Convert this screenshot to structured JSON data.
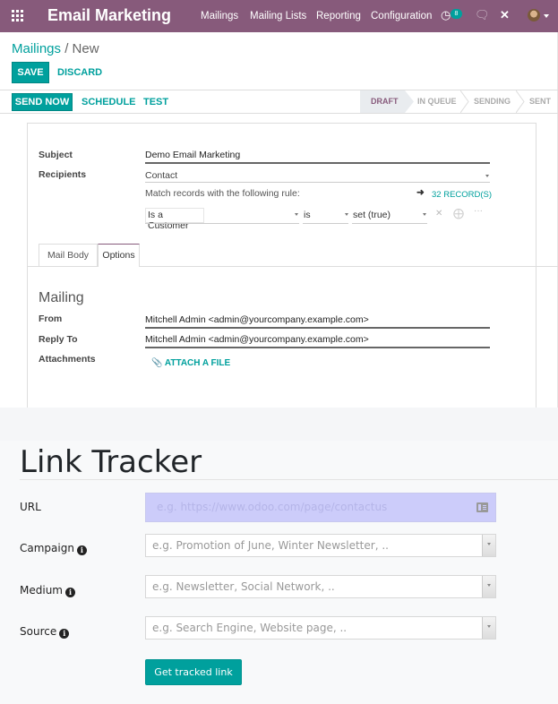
{
  "app": {
    "title": "Email Marketing",
    "menu": [
      "Mailings",
      "Mailing Lists",
      "Reporting",
      "Configuration"
    ],
    "activity_badge": "8",
    "icons": [
      "apps-grid-icon",
      "activity-clock-icon",
      "chat-icon",
      "debug-tools-icon",
      "user-avatar"
    ]
  },
  "breadcrumb": {
    "parent": "Mailings",
    "separator": "/",
    "current": "New"
  },
  "toolbar": {
    "save": "SAVE",
    "discard": "DISCARD"
  },
  "actions": {
    "send_now": "SEND NOW",
    "schedule": "SCHEDULE",
    "test": "TEST"
  },
  "stages": [
    {
      "label": "DRAFT",
      "active": true
    },
    {
      "label": "IN QUEUE",
      "active": false
    },
    {
      "label": "SENDING",
      "active": false
    },
    {
      "label": "SENT",
      "active": false
    }
  ],
  "form": {
    "subject_label": "Subject",
    "subject_value": "Demo Email Marketing",
    "recipients_label": "Recipients",
    "recipients_value": "Contact",
    "rule_text": "Match records with the following rule:",
    "records_link": "32 RECORD(S)",
    "rule": {
      "field": "Is a Customer",
      "operator": "is",
      "value": "set (true)"
    }
  },
  "tabs": [
    {
      "label": "Mail Body",
      "active": false
    },
    {
      "label": "Options",
      "active": true
    }
  ],
  "options": {
    "section_title": "Mailing",
    "from_label": "From",
    "from_value": "Mitchell Admin <admin@yourcompany.example.com>",
    "reply_to_label": "Reply To",
    "reply_to_value": "Mitchell Admin <admin@yourcompany.example.com>",
    "attachments_label": "Attachments",
    "attach_link": "ATTACH A FILE"
  },
  "link_tracker": {
    "title": "Link Tracker",
    "url_label": "URL",
    "url_placeholder": "e.g. https://www.odoo.com/page/contactus",
    "campaign_label": "Campaign",
    "campaign_placeholder": "e.g. Promotion of June, Winter Newsletter, ..",
    "medium_label": "Medium",
    "medium_placeholder": "e.g. Newsletter, Social Network, ..",
    "source_label": "Source",
    "source_placeholder": "e.g. Search Engine, Website page, ..",
    "submit": "Get tracked link"
  },
  "colors": {
    "brand": "#875a7b",
    "accent": "#00a09d"
  }
}
